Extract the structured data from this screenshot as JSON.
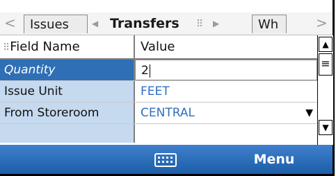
{
  "tabs": {
    "left_arrow": "<",
    "items": [
      {
        "label": "Issues"
      },
      {
        "label": "Transfers"
      },
      {
        "label": "Wh"
      }
    ],
    "right_arrow": ">"
  },
  "grid": {
    "columns": {
      "field": "Field Name",
      "value": "Value"
    },
    "rows": [
      {
        "field": "Quantity",
        "value": "2"
      },
      {
        "field": "Issue Unit",
        "value": "FEET"
      },
      {
        "field": "From Storeroom",
        "value": "CENTRAL"
      }
    ]
  },
  "softkeys": {
    "right": "Menu",
    "center_icon": "keyboard-icon"
  },
  "colors": {
    "selected_row": "#2e6fb5",
    "label_bg": "#c5d9ef",
    "value_text": "#2f6fc0",
    "softbar": "#2a6db8"
  }
}
